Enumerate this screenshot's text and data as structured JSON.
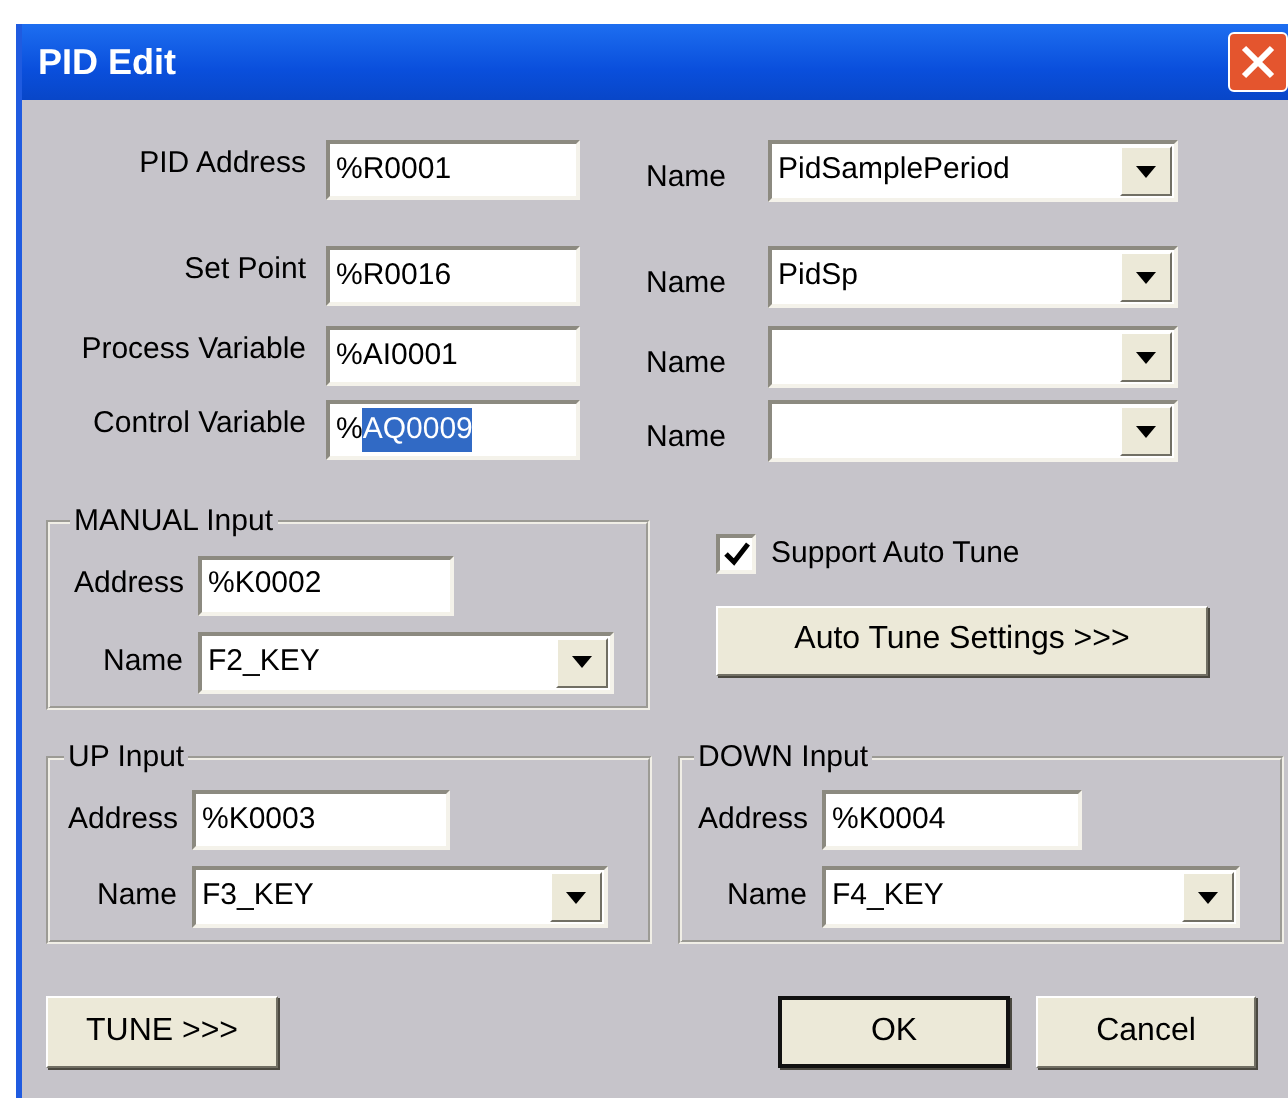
{
  "window": {
    "title": "PID Edit"
  },
  "rows": [
    {
      "label": "PID Address",
      "value_parts": [
        {
          "text": "%R0001",
          "selected": false
        }
      ],
      "name_label": "Name",
      "name_value": "PidSamplePeriod"
    },
    {
      "label": "Set Point",
      "value_parts": [
        {
          "text": "%R0016",
          "selected": false
        }
      ],
      "name_label": "Name",
      "name_value": "PidSp"
    },
    {
      "label": "Process Variable",
      "value_parts": [
        {
          "text": "%AI0001",
          "selected": false
        }
      ],
      "name_label": "Name"
    },
    {
      "label": "Control Variable",
      "value_parts": [
        {
          "text": "%",
          "selected": false
        },
        {
          "text": "AQ0009",
          "selected": true
        }
      ],
      "name_label": "Name"
    }
  ],
  "manual_input": {
    "title": "MANUAL Input",
    "address_label": "Address",
    "address": "%K0002",
    "name_label": "Name",
    "name_value": "F2_KEY"
  },
  "support_auto_tune": {
    "label": "Support Auto Tune",
    "checked": true
  },
  "auto_tune_button": "Auto Tune Settings >>>",
  "up_input": {
    "title": "UP Input",
    "address_label": "Address",
    "address": "%K0003",
    "name_label": "Name",
    "name_value": "F3_KEY"
  },
  "down_input": {
    "title": "DOWN Input",
    "address_label": "Address",
    "address": "%K0004",
    "name_label": "Name",
    "name_value": "F4_KEY"
  },
  "left_buttons": [
    {
      "label": "TUNE >>>",
      "default": false
    }
  ],
  "right_buttons": [
    {
      "label": "OK",
      "default": true
    },
    {
      "label": "Cancel",
      "default": false
    }
  ]
}
